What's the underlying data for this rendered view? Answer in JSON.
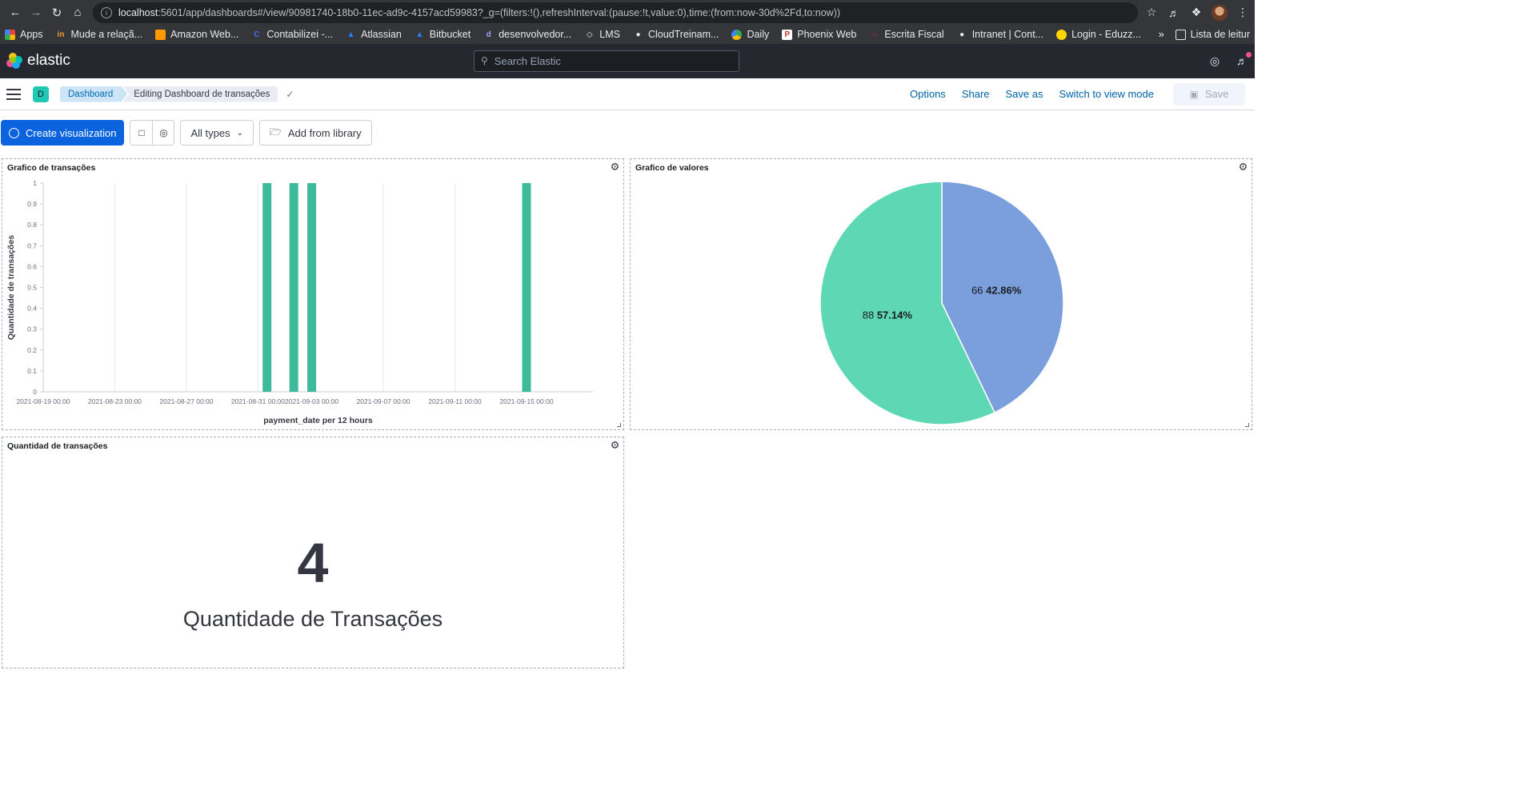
{
  "browser": {
    "url_host": "localhost",
    "url_rest": ":5601/app/dashboards#/view/90981740-18b0-11ec-ad9c-4157acd59983?_g=(filters:!(),refreshInterval:(pause:!t,value:0),time:(from:now-30d%2Fd,to:now))",
    "bookmarks": [
      "Apps",
      "Mude a relaçã...",
      "Amazon Web...",
      "Contabilizei -...",
      "Atlassian",
      "Bitbucket",
      "desenvolvedor...",
      "LMS",
      "CloudTreinam...",
      "Daily",
      "Phoenix Web",
      "Escrita Fiscal",
      "Intranet | Cont...",
      "Login - Eduzz..."
    ],
    "bookmarks_more": "»",
    "reading_list": "Lista de leitur"
  },
  "header": {
    "brand": "elastic",
    "search_placeholder": "Search Elastic"
  },
  "breadcrumb": {
    "space_initial": "D",
    "items": [
      "Dashboard",
      "Editing Dashboard de transações"
    ]
  },
  "top_menu": {
    "options": "Options",
    "share": "Share",
    "save_as": "Save as",
    "switch_mode": "Switch to view mode",
    "save": "Save"
  },
  "toolbar": {
    "create_visualization": "Create visualization",
    "all_types": "All types",
    "add_from_library": "Add from library"
  },
  "panels": {
    "bar": {
      "title": "Grafico de transações"
    },
    "pie": {
      "title": "Grafico de valores"
    },
    "metric": {
      "title": "Quantidad de transações",
      "value": "4",
      "label": "Quantidade de Transações"
    }
  },
  "colors": {
    "bar": "#3dba9a",
    "pie_teal": "#5ed8b4",
    "pie_blue": "#7b9fdc",
    "primary": "#0b64dd"
  },
  "chart_data": [
    {
      "type": "bar",
      "title": "",
      "xlabel": "payment_date per 12 hours",
      "ylabel": "Quantidade de transações",
      "x_ticks": [
        "2021-08-19 00:00",
        "2021-08-23 00:00",
        "2021-08-27 00:00",
        "2021-08-31 00:00",
        "2021-09-03 00:00",
        "2021-09-07 00:00",
        "2021-09-11 00:00",
        "2021-09-15 00:00"
      ],
      "y_ticks": [
        "0",
        "0.1",
        "0.2",
        "0.3",
        "0.4",
        "0.5",
        "0.6",
        "0.7",
        "0.8",
        "0.9",
        "1"
      ],
      "ylim": [
        0,
        1
      ],
      "series": [
        {
          "values": [
            {
              "x": "2021-08-31 12:00",
              "y": 1
            },
            {
              "x": "2021-09-02 00:00",
              "y": 1
            },
            {
              "x": "2021-09-03 00:00",
              "y": 1
            },
            {
              "x": "2021-09-15 00:00",
              "y": 1
            }
          ]
        }
      ],
      "grid": true
    },
    {
      "type": "pie",
      "title": "",
      "slices": [
        {
          "value": 66,
          "label": "66",
          "percent_label": "42.86%"
        },
        {
          "value": 88,
          "label": "88",
          "percent_label": "57.14%"
        }
      ]
    }
  ]
}
